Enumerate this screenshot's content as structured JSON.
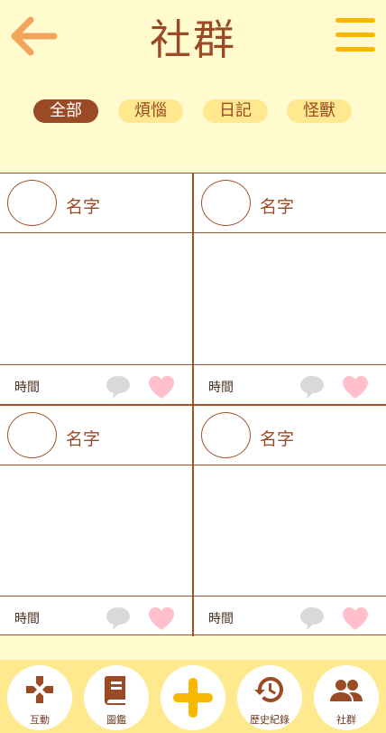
{
  "header": {
    "title": "社群",
    "back_icon": "arrow-left-icon",
    "menu_icon": "hamburger-menu-icon"
  },
  "filters": [
    {
      "label": "全部",
      "active": true
    },
    {
      "label": "煩惱",
      "active": false
    },
    {
      "label": "日記",
      "active": false
    },
    {
      "label": "怪獸",
      "active": false
    }
  ],
  "posts": [
    {
      "name": "名字",
      "time": "時間"
    },
    {
      "name": "名字",
      "time": "時間"
    },
    {
      "name": "名字",
      "time": "時間"
    },
    {
      "name": "名字",
      "time": "時間"
    }
  ],
  "nav": [
    {
      "label": "互動",
      "icon": "gamepad-icon"
    },
    {
      "label": "圖鑑",
      "icon": "book-icon"
    },
    {
      "label": "",
      "icon": "plus-icon"
    },
    {
      "label": "歷史紀錄",
      "icon": "history-icon"
    },
    {
      "label": "社群",
      "icon": "people-icon"
    }
  ],
  "colors": {
    "background": "#fffbcf",
    "brand_brown": "#9a4a25",
    "accent_yellow": "#f6b800",
    "back_orange": "#f3a35a",
    "chip_bg": "#ffe88e",
    "heart_pink": "#ffc0cb",
    "comment_gray": "#d9d9d9"
  }
}
